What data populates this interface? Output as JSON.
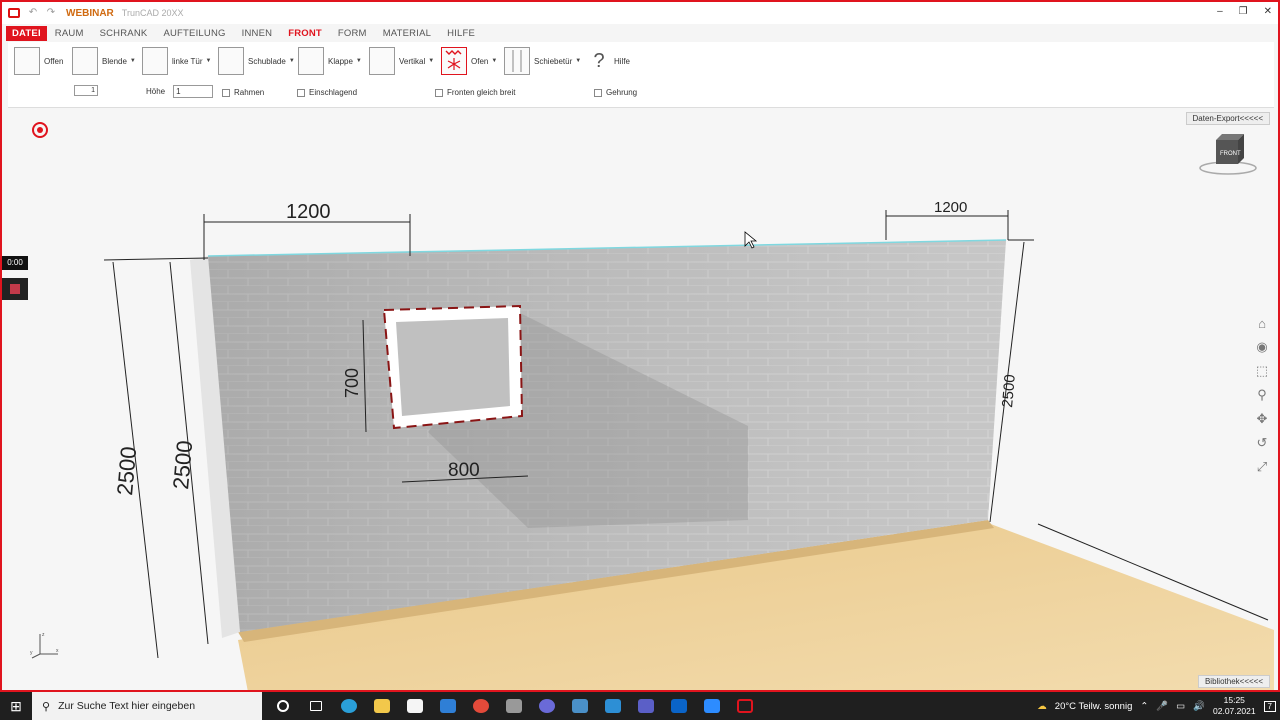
{
  "titlebar": {
    "project": "WEBINAR",
    "app_name": "TrunCAD 20XX",
    "controls": [
      "–",
      "❐",
      "✕"
    ]
  },
  "menu": {
    "items": [
      {
        "label": "DATEI"
      },
      {
        "label": "RAUM"
      },
      {
        "label": "SCHRANK"
      },
      {
        "label": "AUFTEILUNG"
      },
      {
        "label": "INNEN"
      },
      {
        "label": "FRONT"
      },
      {
        "label": "FORM"
      },
      {
        "label": "MATERIAL"
      },
      {
        "label": "HILFE"
      }
    ],
    "active": "FRONT"
  },
  "ribbon": {
    "buttons": {
      "offen": "Offen",
      "blende": "Blende",
      "linke_tuer": "linke Tür",
      "schublade": "Schublade",
      "klappe": "Klappe",
      "vertikal": "Vertikal",
      "ofen": "Ofen",
      "schiebetuer": "Schiebetür",
      "hilfe": "Hilfe"
    },
    "options": {
      "count_value": "1",
      "hoehe_label": "Höhe",
      "hoehe_value": "1",
      "rahmen": "Rahmen",
      "einschlagend": "Einschlagend",
      "fronten_gleich_breit": "Fronten gleich breit",
      "gehrung": "Gehrung"
    }
  },
  "viewport": {
    "data_export": "Daten-Export<<<<<",
    "library": "Bibliothek<<<<<",
    "navcube_label": "FRONT",
    "timer": "0:00",
    "dimensions": {
      "top_left_width": "1200",
      "top_right_width": "1200",
      "left_height_outer": "2500",
      "left_height_inner": "2500",
      "right_height": "2500",
      "window_height": "700",
      "window_width": "800"
    },
    "axes": {
      "x": "x",
      "y": "y",
      "z": "z"
    }
  },
  "taskbar": {
    "search_placeholder": "Zur Suche Text hier eingeben",
    "weather": "20°C  Teilw. sonnig",
    "time": "15:25",
    "date": "02.07.2021",
    "notifications": "7"
  }
}
